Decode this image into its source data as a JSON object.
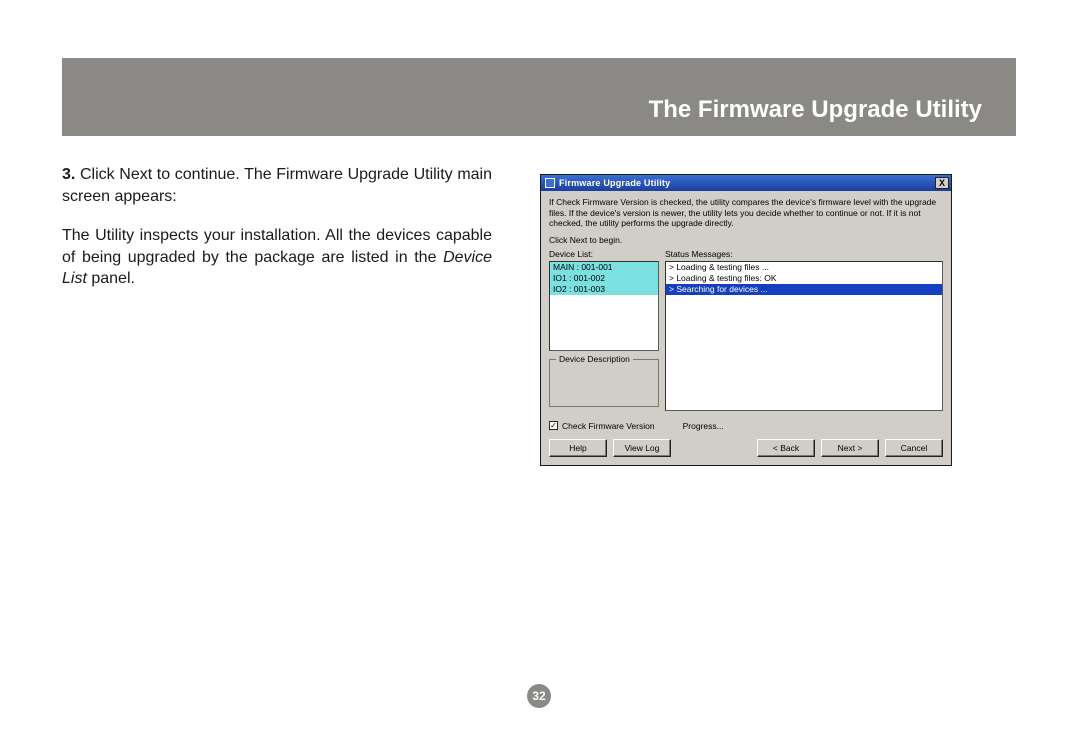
{
  "header": {
    "title": "The Firmware Upgrade Utility"
  },
  "body": {
    "step_number": "3.",
    "step_text": " Click Next to continue. The Firmware Upgrade Utility main screen appears:",
    "para2_a": "The Utility inspects your installation. All the devices capable of being upgraded by the package are listed in the ",
    "para2_italic": "Device List",
    "para2_b": " panel."
  },
  "wizard": {
    "title": "Firmware Upgrade Utility",
    "close": "X",
    "info": "If Check Firmware Version is checked, the utility compares the device's firmware level with the upgrade files. If the device's version is newer, the utility lets you decide whether to continue or not. If it is not checked, the utility performs the upgrade directly.",
    "click_next": "Click Next to begin.",
    "device_list_label": "Device List:",
    "status_label": "Status Messages:",
    "devices": [
      {
        "text": "MAIN : 001-001",
        "hl": "cyan"
      },
      {
        "text": "IO1 : 001-002",
        "hl": "cyan"
      },
      {
        "text": "IO2 : 001-003",
        "hl": "cyan"
      }
    ],
    "status": [
      {
        "text": "> Loading & testing files ...",
        "hl": ""
      },
      {
        "text": "> Loading & testing files: OK",
        "hl": ""
      },
      {
        "text": "> Searching for devices ...",
        "hl": "blue"
      }
    ],
    "desc_label": "Device Description",
    "check_label": "Check Firmware Version",
    "progress_label": "Progress...",
    "buttons": {
      "help": "Help",
      "viewlog": "View Log",
      "back": "< Back",
      "next": "Next >",
      "cancel": "Cancel"
    }
  },
  "page_number": "32"
}
